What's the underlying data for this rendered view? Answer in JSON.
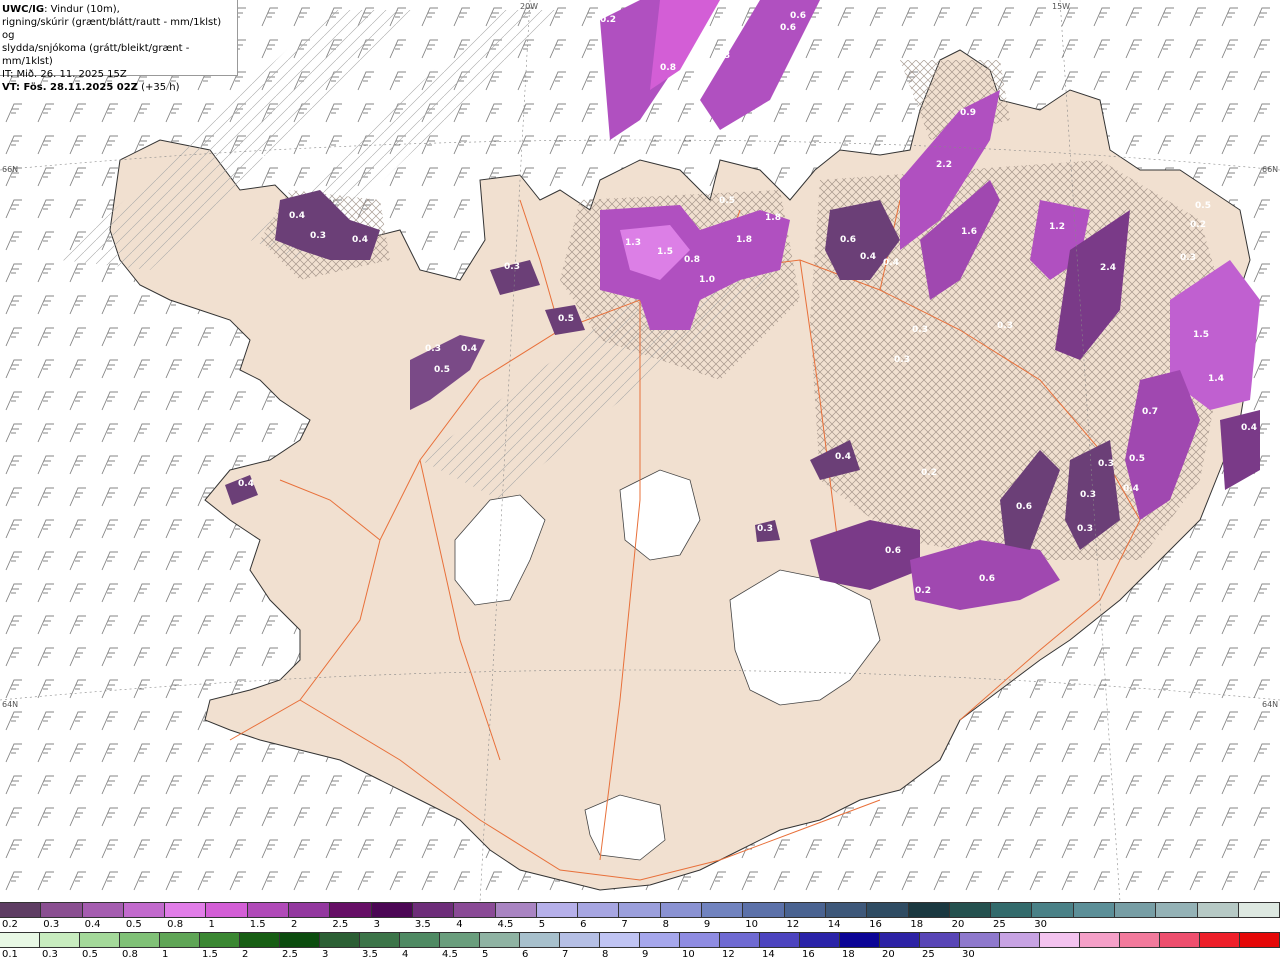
{
  "header": {
    "product": "UWC/IG",
    "line1_rest": ": Vindur (10m),",
    "line2": "rigning/skúrir (grænt/blátt/rautt - mm/1klst) og",
    "line3": "slydda/snjókoma (grátt/bleikt/grænt - mm/1klst)",
    "line4": "IT: Mið. 26. 11. 2025 15Z",
    "line5_bold": "VT: Fös. 28.11.2025 02Z",
    "line5_rest": " (+35 h)"
  },
  "map_labels": {
    "edge_top_1": "20W",
    "edge_top_2": "15W",
    "edge_left_1": "66N",
    "edge_left_2": "64N",
    "edge_right_1": "66N",
    "edge_right_2": "64N"
  },
  "precip_values": [
    "0.2",
    "0.6",
    "0.8",
    "0.6",
    "0.8",
    "0.9",
    "2.2",
    "0.2",
    "0.4",
    "0.3",
    "0.4",
    "0.5",
    "1.8",
    "1.3",
    "1.5",
    "0.8",
    "1.8",
    "1.0",
    "0.6",
    "0.4",
    "0.4",
    "1.6",
    "1.2",
    "0.3",
    "2.4",
    "0.3",
    "0.5",
    "0.3",
    "0.4",
    "0.5",
    "0.5",
    "0.3",
    "0.3",
    "1.5",
    "1.4",
    "0.7",
    "0.4",
    "0.2",
    "0.3",
    "0.5",
    "0.4",
    "0.3",
    "0.6",
    "0.3",
    "0.4",
    "0.6",
    "0.2",
    "0.6",
    "0.3",
    "0.4",
    "0.3",
    "0.2"
  ],
  "legend_top": {
    "colors": [
      "#5e3d63",
      "#8a4f91",
      "#a55db0",
      "#c26acd",
      "#e17de8",
      "#d35ed6",
      "#b04ab8",
      "#93389f",
      "#660f66",
      "#4b0654",
      "#6d2d79",
      "#8a4a96",
      "#a984c2",
      "#b6b0ea",
      "#a7a6e2",
      "#9b9fdc",
      "#8a92d2",
      "#7183bf",
      "#5c71a9",
      "#4a6391",
      "#3e587a",
      "#2f4c63",
      "#1a3840",
      "#24514f",
      "#336b6c",
      "#4a8187",
      "#5c8f98",
      "#779ea5",
      "#94b2b6",
      "#b6c9c5",
      "#dde8e1"
    ],
    "labels": [
      "0.2",
      "0.3",
      "0.4",
      "0.5",
      "0.8",
      "1",
      "1.5",
      "2",
      "2.5",
      "3",
      "3.5",
      "4",
      "4.5",
      "5",
      "6",
      "7",
      "8",
      "9",
      "10",
      "12",
      "14",
      "16",
      "18",
      "20",
      "25",
      "30"
    ]
  },
  "legend_bottom": {
    "colors": [
      "#e8f8e5",
      "#c8ecbf",
      "#a4d99a",
      "#80c177",
      "#5fa556",
      "#3a8732",
      "#175e14",
      "#0b4c0e",
      "#2b5f34",
      "#3c7549",
      "#4f8a63",
      "#6a9e7d",
      "#8fb3a3",
      "#a7c0cc",
      "#b5bfe5",
      "#c0c4f3",
      "#a6a7ec",
      "#8f8ce2",
      "#6f6ad2",
      "#4d44bf",
      "#2a23a8",
      "#0b0496",
      "#2d22a5",
      "#5845b6",
      "#8e78cc",
      "#c7a3e3",
      "#f3c3ef",
      "#f5a0c8",
      "#f27a9c",
      "#ee4f6e",
      "#ee1f2a",
      "#e50808"
    ],
    "labels": [
      "0.1",
      "0.3",
      "0.5",
      "0.8",
      "1",
      "1.5",
      "2",
      "2.5",
      "3",
      "3.5",
      "4",
      "4.5",
      "5",
      "6",
      "7",
      "8",
      "9",
      "10",
      "12",
      "14",
      "16",
      "18",
      "20",
      "25",
      "30"
    ]
  },
  "colors": {
    "land": "#f1e0d0",
    "ice": "#ffffff",
    "sea": "#ffffff",
    "roads": "#e8703a",
    "coast": "#222222",
    "barbs": "#777777"
  }
}
